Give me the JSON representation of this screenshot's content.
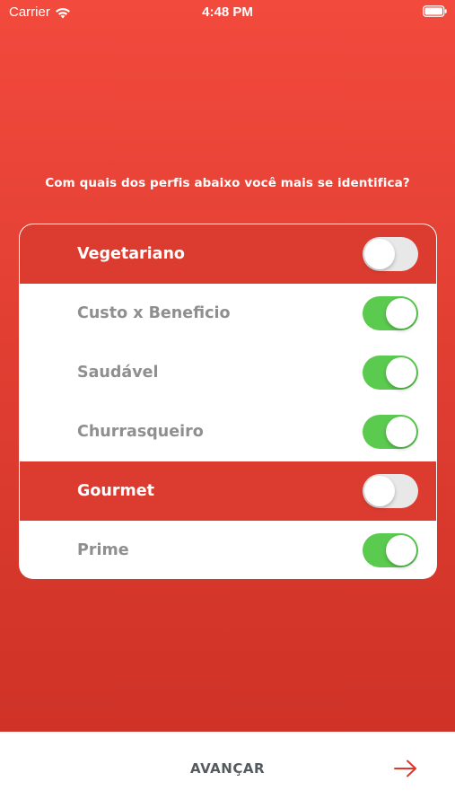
{
  "status_bar": {
    "carrier": "Carrier",
    "time": "4:48 PM",
    "icons": [
      "wifi-icon",
      "battery-icon"
    ]
  },
  "question": "Com quais dos perfis abaixo você mais se identifica?",
  "profiles": [
    {
      "label": "Vegetariano",
      "enabled": false
    },
    {
      "label": "Custo x Beneficio",
      "enabled": true
    },
    {
      "label": "Saudável",
      "enabled": true
    },
    {
      "label": "Churrasqueiro",
      "enabled": true
    },
    {
      "label": "Gourmet",
      "enabled": false
    },
    {
      "label": "Prime",
      "enabled": true
    }
  ],
  "footer": {
    "next_label": "AVANÇAR",
    "next_icon": "arrow-right-icon"
  },
  "colors": {
    "background_top": "#f24a3d",
    "background_bottom": "#cf3226",
    "row_off": "#dc3b2f",
    "toggle_on": "#5bcb4f",
    "toggle_off": "#e8e8e8",
    "arrow": "#e0372b"
  }
}
